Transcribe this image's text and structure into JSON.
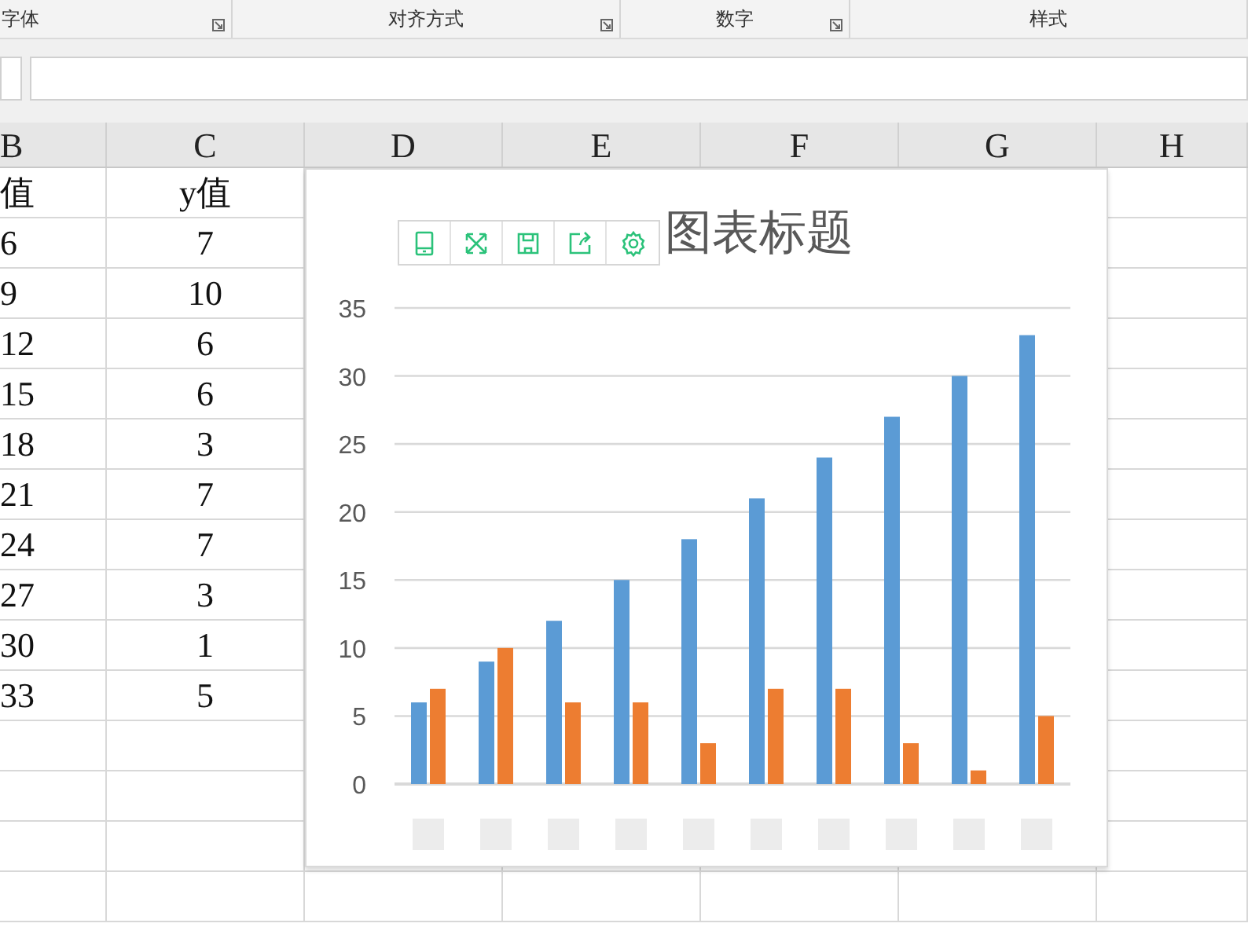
{
  "ribbon_groups": [
    {
      "label": "字体",
      "launcher": true
    },
    {
      "label": "对齐方式",
      "launcher": true
    },
    {
      "label": "数字",
      "launcher": true
    },
    {
      "label": "样式",
      "launcher": false
    }
  ],
  "columns": [
    "B",
    "C",
    "D",
    "E",
    "F",
    "G",
    "H"
  ],
  "rows": [
    [
      "值",
      "y值"
    ],
    [
      "6",
      "7"
    ],
    [
      "9",
      "10"
    ],
    [
      "12",
      "6"
    ],
    [
      "15",
      "6"
    ],
    [
      "18",
      "3"
    ],
    [
      "21",
      "7"
    ],
    [
      "24",
      "7"
    ],
    [
      "27",
      "3"
    ],
    [
      "30",
      "1"
    ],
    [
      "33",
      "5"
    ]
  ],
  "chart": {
    "title": "图表标题",
    "chart_data": {
      "type": "bar",
      "grid": true,
      "yticks": [
        0,
        5,
        10,
        15,
        20,
        25,
        30,
        35
      ],
      "ylim": [
        0,
        35
      ],
      "series": [
        {
          "color": "#5b9bd5",
          "values": [
            6,
            9,
            12,
            15,
            18,
            21,
            24,
            27,
            30,
            33
          ]
        },
        {
          "color": "#ed7d31",
          "values": [
            7,
            10,
            6,
            6,
            3,
            7,
            7,
            3,
            1,
            5
          ]
        }
      ]
    }
  }
}
